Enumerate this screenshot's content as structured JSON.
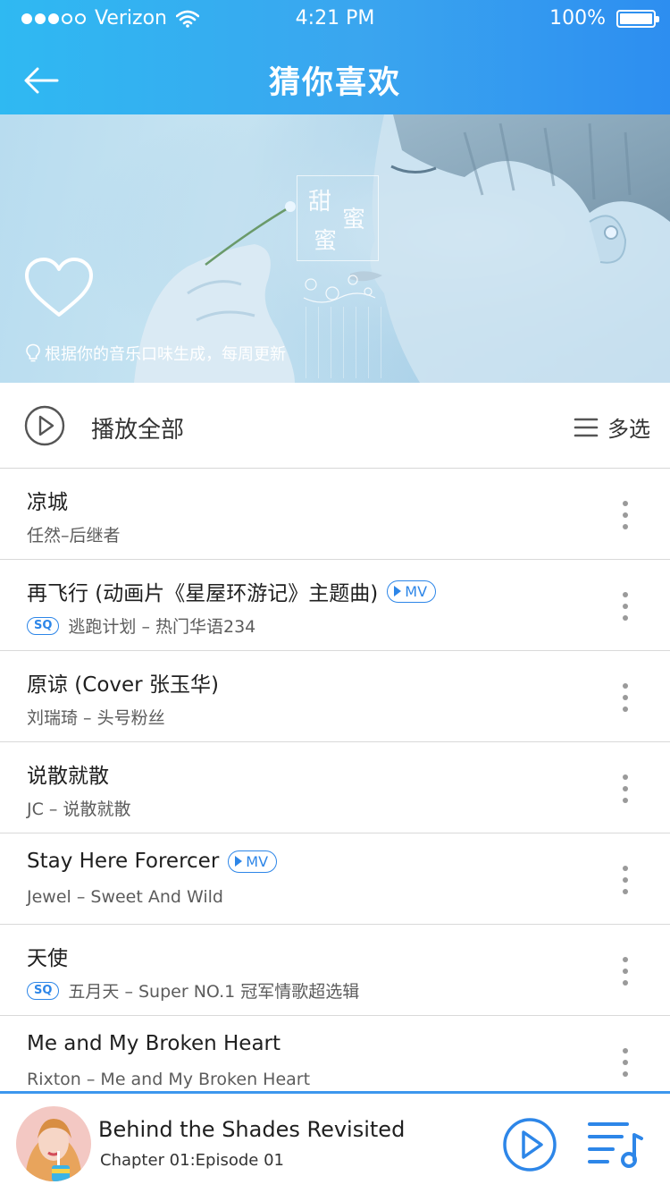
{
  "status_bar": {
    "carrier": "Verizon",
    "time": "4:21 PM",
    "battery": "100%",
    "battery_level": 1.0,
    "signal_bars": 3
  },
  "header": {
    "title": "猜你喜欢",
    "back_icon": "arrow-left-icon"
  },
  "banner": {
    "tagline": "根据你的音乐口味生成，每周更新",
    "stamp_chars": [
      "甜",
      "蜜",
      "蜜"
    ],
    "heart_icon": "heart-outline-icon",
    "bulb_icon": "lightbulb-icon"
  },
  "actions": {
    "play_all": "播放全部",
    "multi_select": "多选"
  },
  "songs": [
    {
      "title": "凉城",
      "subtitle": "任然–后继者",
      "mv": false,
      "sq": false
    },
    {
      "title": "再飞行 (动画片《星屋环游记》主题曲)",
      "subtitle": "逃跑计划 – 热门华语234",
      "mv": true,
      "sq": true
    },
    {
      "title": "原谅 (Cover 张玉华)",
      "subtitle": "刘瑞琦 – 头号粉丝",
      "mv": false,
      "sq": false
    },
    {
      "title": "说散就散",
      "subtitle": "JC – 说散就散",
      "mv": false,
      "sq": false
    },
    {
      "title": "Stay Here Forercer",
      "subtitle": "Jewel – Sweet And Wild",
      "mv": true,
      "sq": false
    },
    {
      "title": "天使",
      "subtitle": "五月天 – Super NO.1 冠军情歌超选辑",
      "mv": false,
      "sq": true
    },
    {
      "title": "Me and My Broken Heart",
      "subtitle": "Rixton – Me and My Broken Heart",
      "mv": false,
      "sq": false
    }
  ],
  "labels": {
    "mv": "MV",
    "sq": "SQ"
  },
  "player": {
    "title": "Behind the Shades Revisited",
    "subtitle": "Chapter 01:Episode 01",
    "play_icon": "play-circle-icon",
    "playlist_icon": "playlist-music-icon"
  },
  "colors": {
    "accent": "#2d86e8",
    "header_start": "#2fb9f2",
    "header_end": "#2d8ef0"
  }
}
